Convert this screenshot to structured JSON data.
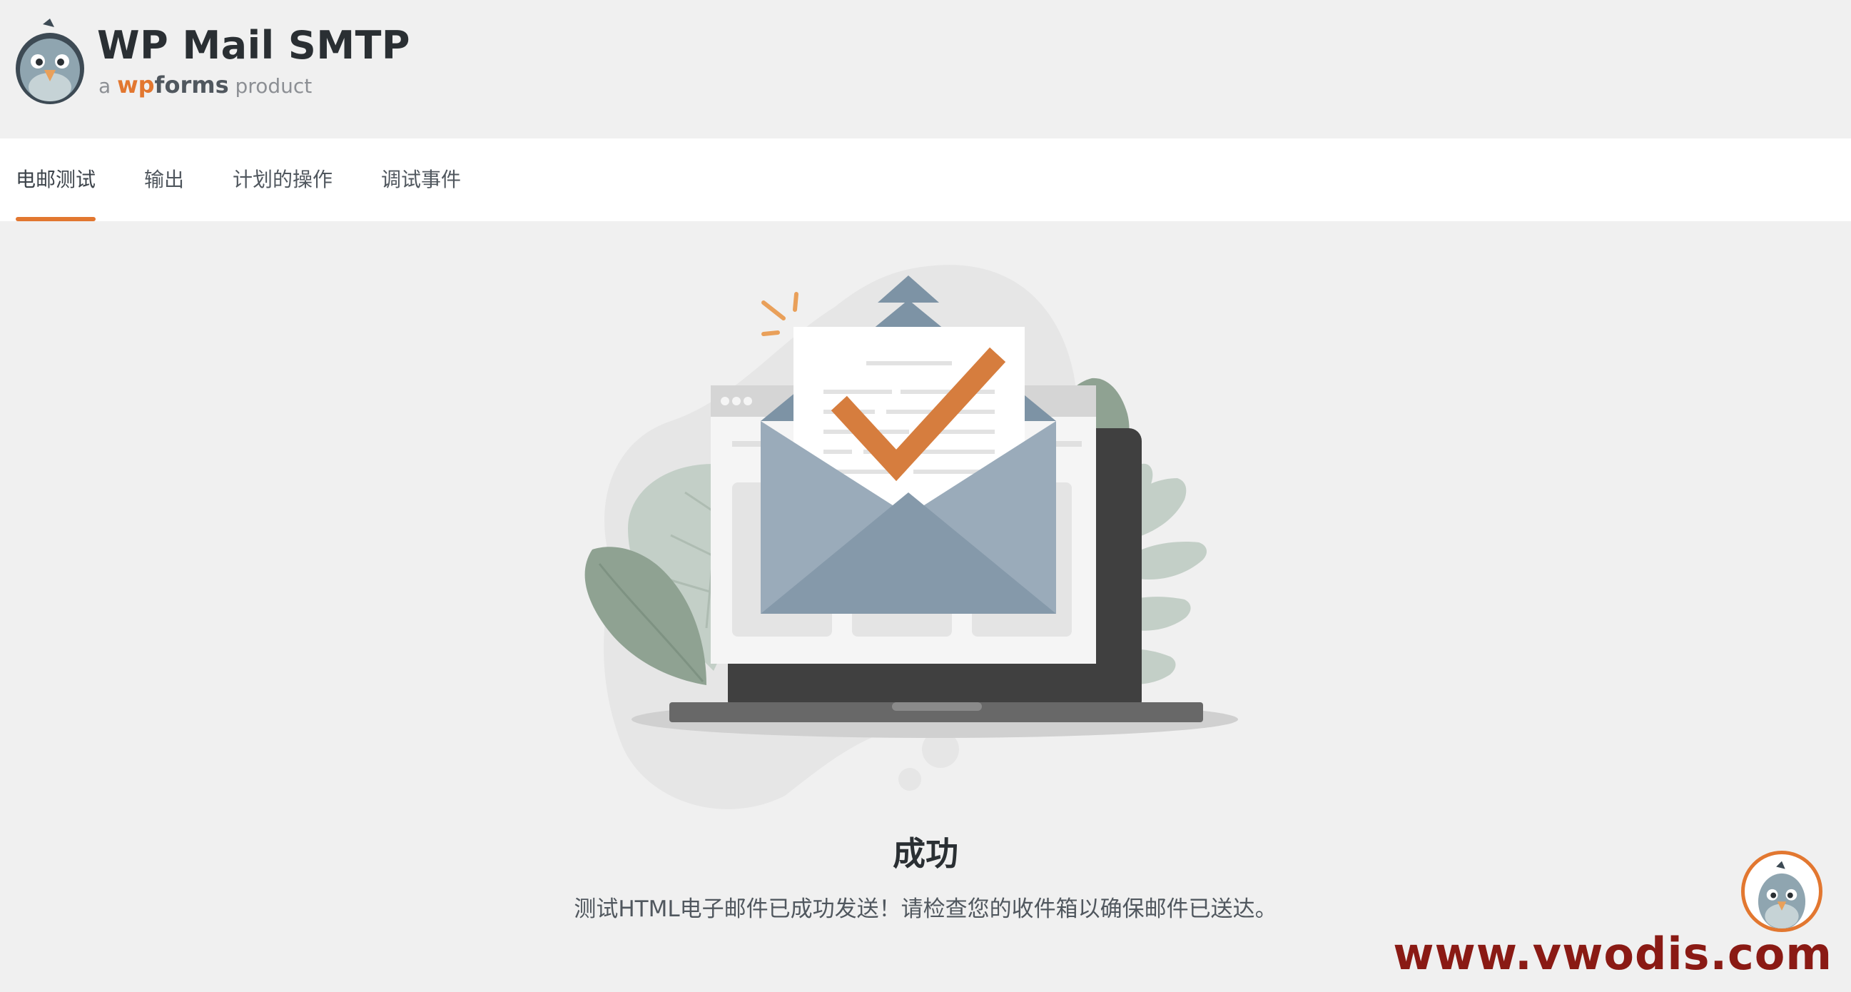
{
  "header": {
    "title": "WP Mail SMTP",
    "subtitle_a": "a",
    "subtitle_brand_wp": "wp",
    "subtitle_brand_forms": "forms",
    "subtitle_product": "product"
  },
  "tabs": [
    {
      "label": "电邮测试",
      "active": true
    },
    {
      "label": "输出",
      "active": false
    },
    {
      "label": "计划的操作",
      "active": false
    },
    {
      "label": "调试事件",
      "active": false
    }
  ],
  "result": {
    "title": "成功",
    "message": "测试HTML电子邮件已成功发送！请检查您的收件箱以确保邮件已送达。"
  },
  "watermark": "www.vwodis.com",
  "colors": {
    "accent": "#e27730",
    "background": "#f0f0f0",
    "tabbar": "#ffffff",
    "envelope": "#9aabba",
    "checkmark": "#d67d3e"
  },
  "icons": {
    "logo": "pigeon-mascot-icon",
    "help": "pigeon-help-icon",
    "illustration": "email-success-illustration"
  }
}
